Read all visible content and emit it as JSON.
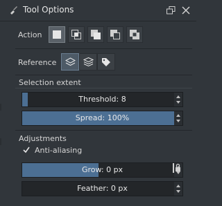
{
  "titlebar": {
    "title": "Tool Options",
    "tool_icon": "brush-tool-icon",
    "float_icon": "float-window-icon",
    "close_icon": "close-icon"
  },
  "action": {
    "label": "Action",
    "modes": [
      "replace",
      "intersect",
      "add",
      "subtract",
      "symmetric-difference"
    ],
    "active_index": 0
  },
  "reference": {
    "label": "Reference",
    "options": [
      "current-layer",
      "all-layers",
      "color-labeled-layers"
    ],
    "active_index": 0
  },
  "selection_extent": {
    "heading": "Selection extent",
    "threshold": {
      "text": "Threshold: 8",
      "fraction": 0.035
    },
    "spread": {
      "text": "Spread: 100%",
      "fraction": 1.0
    }
  },
  "adjustments": {
    "heading": "Adjustments",
    "antialiasing": {
      "label": "Anti-aliasing",
      "checked": true
    },
    "grow": {
      "text": "Grow: 0 px",
      "fraction": 0.5
    },
    "feather": {
      "text": "Feather: 0 px",
      "fraction": 0.0
    },
    "grow_lock_icon": "grow-lock-icon"
  },
  "colors": {
    "background": "#31363b",
    "slider_fill": "#4c6f93",
    "field": "#232629"
  }
}
